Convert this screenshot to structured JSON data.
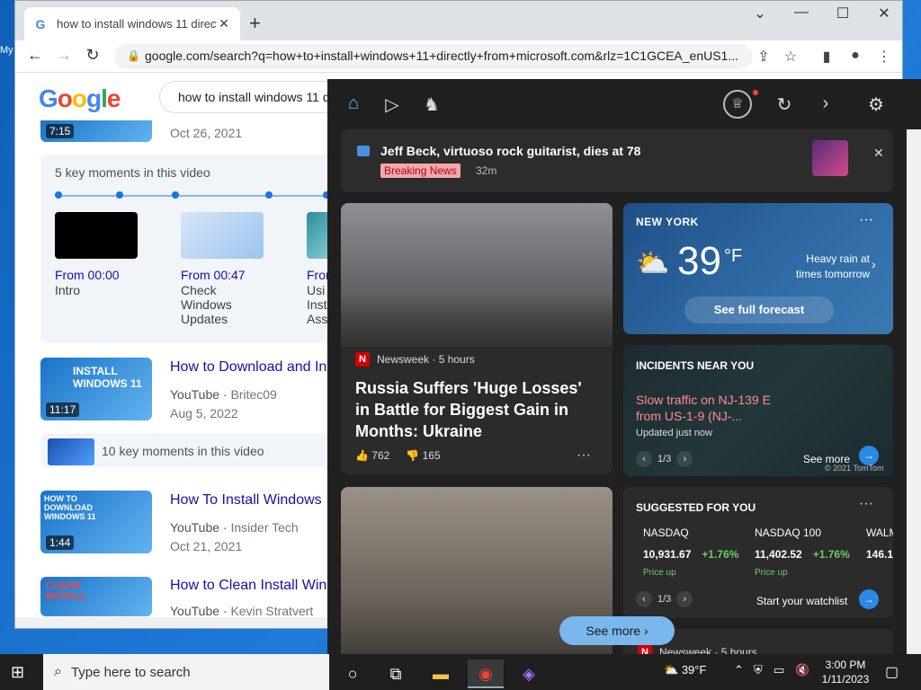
{
  "desktop": {
    "icon_label": "My"
  },
  "browser": {
    "tab_title": "how to install windows 11 directly",
    "tab_favicon": "G",
    "url": "google.com/search?q=how+to+install+windows+11+directly+from+microsoft.com&rlz=1C1GCEA_enUS1..."
  },
  "google": {
    "logo": "Google",
    "query": "how to install windows 11 d",
    "first": {
      "duration": "7:15",
      "date": "Oct 26, 2021"
    },
    "key_moments": {
      "header": "5 key moments in this video",
      "items": [
        {
          "time": "From 00:00",
          "label": "Intro"
        },
        {
          "time": "From 00:47",
          "label": "Check Windows Updates"
        },
        {
          "time": "From",
          "label": "Usi Inst Ass"
        }
      ]
    },
    "results": [
      {
        "title": "How to Download and In",
        "source": "YouTube",
        "author": "Britec09",
        "date": "Aug 5, 2022",
        "duration": "11:17",
        "thumb_text": "INSTALL WINDOWS 11"
      },
      {
        "title": "How To Install Windows",
        "source": "YouTube",
        "author": "Insider Tech",
        "date": "Oct 21, 2021",
        "duration": "1:44",
        "thumb_text": "HOW TO DOWNLOAD WINDOWS 11"
      },
      {
        "title": "How to Clean Install Win",
        "source": "YouTube",
        "author": "Kevin Stratvert",
        "date": "",
        "duration": "",
        "thumb_text": "CLEAN INSTALL"
      }
    ],
    "key_moments_2": "10 key moments in this video"
  },
  "widgets": {
    "breaking": {
      "headline": "Jeff Beck, virtuoso rock guitarist, dies at 78",
      "badge": "Breaking News",
      "ago": "32m"
    },
    "news1": {
      "source": "Newsweek",
      "time": "5 hours",
      "headline": "Russia Suffers 'Huge Losses' in Battle for Biggest Gain in Months: Ukraine",
      "likes": "762",
      "dislikes": "165"
    },
    "weather": {
      "city": "NEW YORK",
      "temp": "39",
      "unit": "°F",
      "forecast": "Heavy rain at times tomorrow",
      "button": "See full forecast"
    },
    "traffic": {
      "header": "INCIDENTS NEAR YOU",
      "alert": "Slow traffic on NJ-139 E from US-1-9 (NJ-...",
      "updated": "Updated just now",
      "page": "1/3",
      "see_more": "See more",
      "copyright": "© 2021 TomTom"
    },
    "suggest": {
      "header": "SUGGESTED FOR YOU",
      "stocks": [
        {
          "name": "NASDAQ",
          "value": "10,931.67",
          "change": "+1.76%",
          "note": "Price up"
        },
        {
          "name": "NASDAQ 100",
          "value": "11,402.52",
          "change": "+1.76%",
          "note": "Price up"
        },
        {
          "name": "WALM",
          "value": "146.1",
          "change": "",
          "note": ""
        }
      ],
      "page": "1/3",
      "watchlist": "Start your watchlist"
    },
    "see_more": "See more",
    "news3": {
      "source": "Newsweek",
      "time": "5 hours"
    }
  },
  "taskbar": {
    "search_placeholder": "Type here to search",
    "weather_temp": "39°F",
    "time": "3:00 PM",
    "date": "1/11/2023"
  }
}
